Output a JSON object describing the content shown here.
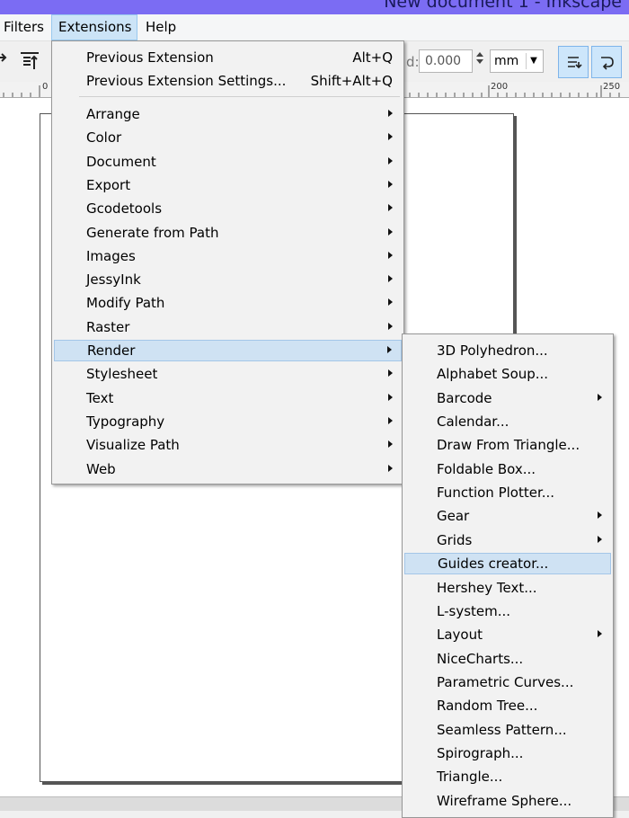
{
  "window": {
    "title": "New document 1 - Inkscape"
  },
  "menubar": {
    "filters": "Filters",
    "extensions": "Extensions",
    "help": "Help"
  },
  "toolbar": {
    "field_label": "d:",
    "value": "0.000",
    "unit": "mm"
  },
  "ruler": {
    "labels": [
      "0",
      "200",
      "250"
    ]
  },
  "extensions_menu": {
    "previous_extension": {
      "label": "Previous Extension",
      "shortcut": "Alt+Q"
    },
    "previous_extension_settings": {
      "label": "Previous Extension Settings...",
      "shortcut": "Shift+Alt+Q"
    },
    "items": [
      "Arrange",
      "Color",
      "Document",
      "Export",
      "Gcodetools",
      "Generate from Path",
      "Images",
      "JessyInk",
      "Modify Path",
      "Raster",
      "Render",
      "Stylesheet",
      "Text",
      "Typography",
      "Visualize Path",
      "Web"
    ],
    "highlighted": "Render"
  },
  "render_submenu": {
    "items": [
      "3D Polyhedron...",
      "Alphabet Soup...",
      "Barcode",
      "Calendar...",
      "Draw From Triangle...",
      "Foldable Box...",
      "Function Plotter...",
      "Gear",
      "Grids",
      "Guides creator...",
      "Hershey Text...",
      "L-system...",
      "Layout",
      "NiceCharts...",
      "Parametric Curves...",
      "Random Tree...",
      "Seamless Pattern...",
      "Spirograph...",
      "Triangle...",
      "Wireframe Sphere..."
    ],
    "with_submenu": [
      "Barcode",
      "Gear",
      "Grids",
      "Layout"
    ],
    "highlighted": "Guides creator..."
  },
  "colors": {
    "highlight": "#cfe2f3",
    "menu_bg": "#f2f2f2",
    "title_bar": "#7b6cf3"
  }
}
